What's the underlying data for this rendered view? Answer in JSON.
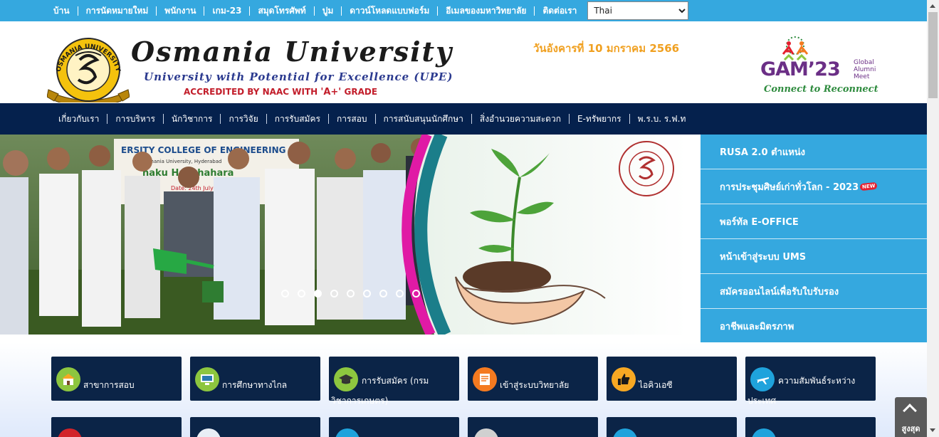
{
  "topbar": {
    "links": [
      "บ้าน",
      "การนัดหมายใหม่",
      "พนักงาน",
      "เกม-23",
      "สมุดโทรศัพท์",
      "ปูม",
      "ดาวน์โหลดแบบฟอร์ม",
      "อีเมลของมหาวิทยาลัย",
      "ติดต่อเรา"
    ],
    "language": "Thai"
  },
  "header": {
    "seal_text": "OSMANIA UNIVERSITY",
    "title": "Osmania University",
    "tagline": "University with Potential for Excellence (UPE)",
    "naac": "ACCREDITED BY NAAC WITH",
    "naac_grade": "'A+'",
    "naac_suffix": "GRADE",
    "date": "วันอังคารที่ 10 มกราคม 2566",
    "gam": {
      "word": "GAM’23",
      "sub": [
        "Global",
        "Alumni",
        "Meet"
      ],
      "connect": "Connect to Reconnect"
    }
  },
  "mainnav": [
    "เกี่ยวกับเรา",
    "การบริหาร",
    "นักวิชาการ",
    "การวิจัย",
    "การรับสมัคร",
    "การสอบ",
    "การสนับสนุนนักศึกษา",
    "สิ่งอำนวยความสะดวก",
    "E-ทรัพยากร",
    "พ.ร.บ. ร.ฟ.ท"
  ],
  "slider": {
    "banner_text": "ERSITY COLLEGE OF ENGINEERING",
    "banner_sub": "Osmania University, Hyderabad",
    "banner_event": "naku Harithahara",
    "banner_date": "Date: 24th July",
    "slide_count": 9,
    "active_slide": 3
  },
  "sidelinks": [
    {
      "label": "RUSA 2.0 ตำแหน่ง"
    },
    {
      "label": "การประชุมศิษย์เก่าทั่วโลก - 2023",
      "badge": "NEW"
    },
    {
      "label": "พอร์ทัล E-OFFICE"
    },
    {
      "label": "หน้าเข้าสู่ระบบ UMS"
    },
    {
      "label": "สมัครออนไลน์เพื่อรับใบรับรอง"
    },
    {
      "label": "อาชีพและมิตรภาพ"
    }
  ],
  "quicklinks": [
    {
      "label": "สาขาการสอบ",
      "icon": "school-building-icon",
      "color": "#8dc63f"
    },
    {
      "label": "การศึกษาทางไกล",
      "icon": "monitor-icon",
      "color": "#8dc63f"
    },
    {
      "label": "การรับสมัคร (กรมวิชาการเกษตร)",
      "icon": "graduation-cap-icon",
      "color": "#8dc63f"
    },
    {
      "label": "เข้าสู่ระบบวิทยาลัย",
      "icon": "document-icon",
      "color": "#f47a20"
    },
    {
      "label": "ไอคิวเอซี",
      "icon": "thumbs-up-icon",
      "color": "#f7a823"
    },
    {
      "label": "ความสัมพันธ์ระหว่างประเทศ",
      "icon": "airplane-icon",
      "color": "#1fa3dc"
    }
  ],
  "quicklinks_row2": [
    {
      "icon": "graduation-hat-icon",
      "color": "#d2232a"
    },
    {
      "icon": "rocket-icon",
      "color": "#e8eef5"
    },
    {
      "icon": "people-icon",
      "color": "#1fa3dc"
    },
    {
      "icon": "group-icon",
      "color": "#d0d0d0"
    },
    {
      "icon": "accessibility-icon",
      "color": "#1fa3dc"
    },
    {
      "icon": "book-icon",
      "color": "#1fa3dc"
    }
  ],
  "totop": "สูงสุด",
  "colors": {
    "topbar": "#35a8df",
    "nav": "#05214d",
    "tile": "#0b2447",
    "date": "#f0a020",
    "naac": "#c21d2a"
  }
}
